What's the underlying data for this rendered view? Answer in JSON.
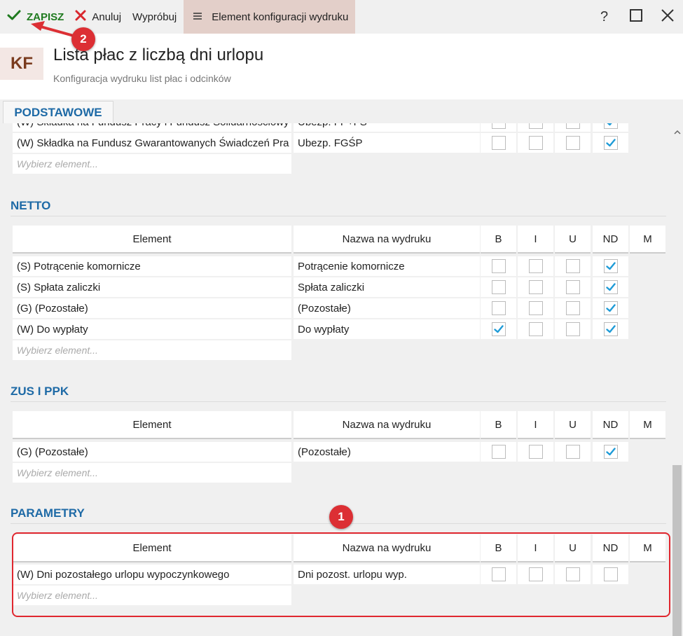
{
  "toolbar": {
    "save_label": "ZAPISZ",
    "cancel_label": "Anuluj",
    "try_label": "Wypróbuj",
    "menu_label": "Element konfiguracji wydruku",
    "help_label": "?"
  },
  "header": {
    "badge": "KF",
    "title": "Lista płac z liczbą dni urlopu",
    "subtitle": "Konfiguracja wydruku list płac i odcinków"
  },
  "tab": {
    "label": "PODSTAWOWE"
  },
  "columns": {
    "element": "Element",
    "name": "Nazwa na wydruku",
    "b": "B",
    "i": "I",
    "u": "U",
    "nd": "ND",
    "m": "M"
  },
  "placeholder": "Wybierz element...",
  "basic": {
    "rows": [
      {
        "element": "(W) Składka na Fundusz Pracy i Fundusz Solidarnościowy",
        "name": "Ubezp. FP+FS",
        "b": false,
        "i": false,
        "u": false,
        "nd": true
      },
      {
        "element": "(W) Składka na Fundusz Gwarantowanych Świadczeń Pra",
        "name": "Ubezp. FGŚP",
        "b": false,
        "i": false,
        "u": false,
        "nd": true
      }
    ]
  },
  "netto": {
    "title": "NETTO",
    "rows": [
      {
        "element": "(S) Potrącenie komornicze",
        "name": "Potrącenie komornicze",
        "b": false,
        "i": false,
        "u": false,
        "nd": true
      },
      {
        "element": "(S) Spłata zaliczki",
        "name": "Spłata zaliczki",
        "b": false,
        "i": false,
        "u": false,
        "nd": true
      },
      {
        "element": "(G) (Pozostałe)",
        "name": "(Pozostałe)",
        "b": false,
        "i": false,
        "u": false,
        "nd": true
      },
      {
        "element": "(W) Do wypłaty",
        "name": "Do wypłaty",
        "b": true,
        "i": false,
        "u": false,
        "nd": true
      }
    ]
  },
  "zus": {
    "title": "ZUS I PPK",
    "rows": [
      {
        "element": "(G) (Pozostałe)",
        "name": "(Pozostałe)",
        "b": false,
        "i": false,
        "u": false,
        "nd": true
      }
    ]
  },
  "parametry": {
    "title": "PARAMETRY",
    "rows": [
      {
        "element": "(W) Dni pozostałego urlopu wypoczynkowego",
        "name": "Dni pozost. urlopu wyp.",
        "b": false,
        "i": false,
        "u": false,
        "nd": false
      }
    ]
  },
  "annotations": {
    "badge1": "1",
    "badge2": "2",
    "color": "#dc2f34"
  },
  "colors": {
    "accent": "#1e6aa6",
    "save": "#1f7a1f",
    "check": "#1e9bd7",
    "menu_bg": "#e3cfc9"
  }
}
